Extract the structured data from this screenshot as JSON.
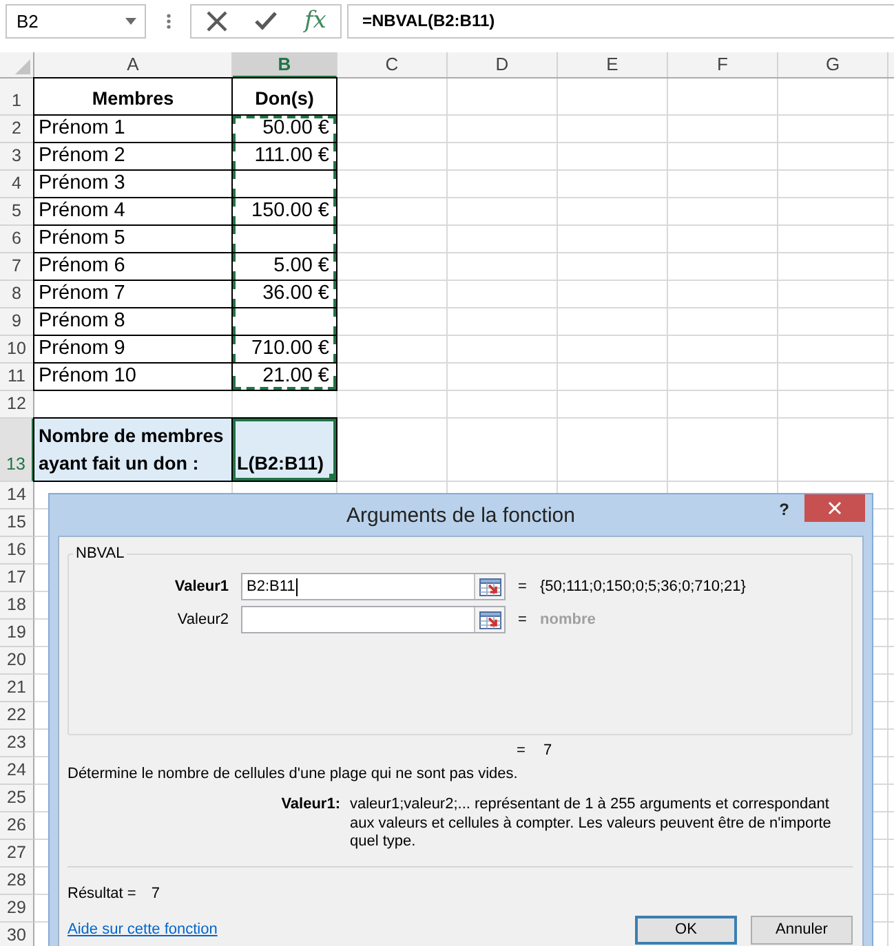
{
  "formula_bar": {
    "name_box": "B2",
    "insert_function": "fx",
    "formula": "=NBVAL(B2:B11)"
  },
  "sheet": {
    "columns": [
      {
        "label": "A",
        "selected": false
      },
      {
        "label": "B",
        "selected": true
      },
      {
        "label": "C",
        "selected": false
      },
      {
        "label": "D",
        "selected": false
      },
      {
        "label": "E",
        "selected": false
      },
      {
        "label": "F",
        "selected": false
      },
      {
        "label": "G",
        "selected": false
      }
    ],
    "rows": [
      {
        "number": "1",
        "selected": false,
        "kind": "header",
        "cells": [
          {
            "text": "Membres",
            "referenced": false,
            "active": false
          },
          {
            "text": "Don(s)",
            "referenced": false,
            "active": false
          }
        ]
      },
      {
        "number": "2",
        "selected": false,
        "kind": "entry",
        "cells": [
          {
            "text": "Prénom 1",
            "referenced": false,
            "active": false
          },
          {
            "text": "50.00 €",
            "referenced": true,
            "active": false
          }
        ]
      },
      {
        "number": "3",
        "selected": false,
        "kind": "entry",
        "cells": [
          {
            "text": "Prénom 2",
            "referenced": false,
            "active": false
          },
          {
            "text": "111.00 €",
            "referenced": true,
            "active": false
          }
        ]
      },
      {
        "number": "4",
        "selected": false,
        "kind": "entry",
        "cells": [
          {
            "text": "Prénom 3",
            "referenced": false,
            "active": false
          },
          {
            "referenced": true,
            "active": false
          }
        ]
      },
      {
        "number": "5",
        "selected": false,
        "kind": "entry",
        "cells": [
          {
            "text": "Prénom 4",
            "referenced": false,
            "active": false
          },
          {
            "text": "150.00 €",
            "referenced": true,
            "active": false
          }
        ]
      },
      {
        "number": "6",
        "selected": false,
        "kind": "entry",
        "cells": [
          {
            "text": "Prénom 5",
            "referenced": false,
            "active": false
          },
          {
            "referenced": true,
            "active": false
          }
        ]
      },
      {
        "number": "7",
        "selected": false,
        "kind": "entry",
        "cells": [
          {
            "text": "Prénom 6",
            "referenced": false,
            "active": false
          },
          {
            "text": "5.00 €",
            "referenced": true,
            "active": false
          }
        ]
      },
      {
        "number": "8",
        "selected": false,
        "kind": "entry",
        "cells": [
          {
            "text": "Prénom 7",
            "referenced": false,
            "active": false
          },
          {
            "text": "36.00 €",
            "referenced": true,
            "active": false
          }
        ]
      },
      {
        "number": "9",
        "selected": false,
        "kind": "entry",
        "cells": [
          {
            "text": "Prénom 8",
            "referenced": false,
            "active": false
          },
          {
            "referenced": true,
            "active": false
          }
        ]
      },
      {
        "number": "10",
        "selected": false,
        "kind": "entry",
        "cells": [
          {
            "text": "Prénom 9",
            "referenced": false,
            "active": false
          },
          {
            "text": "710.00 €",
            "referenced": true,
            "active": false
          }
        ]
      },
      {
        "number": "11",
        "selected": false,
        "kind": "entry",
        "cells": [
          {
            "text": "Prénom 10",
            "referenced": false,
            "active": false
          },
          {
            "text": "21.00 €",
            "referenced": true,
            "active": false
          }
        ]
      },
      {
        "number": "12",
        "selected": false,
        "kind": "blank"
      },
      {
        "number": "13",
        "selected": true,
        "kind": "summary",
        "cells": [
          {
            "text": "Nombre de membres ayant fait un don :",
            "referenced": false,
            "active": false
          },
          {
            "text": "L(B2:B11)",
            "referenced": false,
            "active": true
          }
        ]
      },
      {
        "number": "14",
        "selected": false,
        "kind": "blank"
      },
      {
        "number": "15",
        "selected": false,
        "kind": "blank"
      },
      {
        "number": "16",
        "selected": false,
        "kind": "blank"
      },
      {
        "number": "17",
        "selected": false,
        "kind": "blank"
      },
      {
        "number": "18",
        "selected": false,
        "kind": "blank"
      },
      {
        "number": "19",
        "selected": false,
        "kind": "blank"
      },
      {
        "number": "20",
        "selected": false,
        "kind": "blank"
      },
      {
        "number": "21",
        "selected": false,
        "kind": "blank"
      },
      {
        "number": "22",
        "selected": false,
        "kind": "blank"
      },
      {
        "number": "23",
        "selected": false,
        "kind": "blank"
      },
      {
        "number": "24",
        "selected": false,
        "kind": "blank"
      },
      {
        "number": "25",
        "selected": false,
        "kind": "blank"
      },
      {
        "number": "26",
        "selected": false,
        "kind": "blank"
      },
      {
        "number": "27",
        "selected": false,
        "kind": "blank"
      },
      {
        "number": "28",
        "selected": false,
        "kind": "blank"
      },
      {
        "number": "29",
        "selected": false,
        "kind": "blank"
      },
      {
        "number": "30",
        "selected": false,
        "kind": "blank"
      }
    ]
  },
  "dialog": {
    "title": "Arguments de la fonction",
    "help": "?",
    "function_name": "NBVAL",
    "arguments": [
      {
        "label": "Valeur1",
        "required": true,
        "focused": true,
        "value": "B2:B11",
        "equals": "=",
        "result": "{50;111;0;150;0;5;36;0;710;21}"
      },
      {
        "label": "Valeur2",
        "required": false,
        "focused": false,
        "equals": "=",
        "result_hint": "nombre"
      }
    ],
    "formula_result": {
      "equals": "=",
      "value": "7"
    },
    "description": "Détermine le nombre de cellules d'une plage qui ne sont pas vides.",
    "argument_help": {
      "label": "Valeur1:",
      "text": "valeur1;valeur2;... représentant de 1 à 255 arguments et correspondant aux valeurs et cellules à compter. Les valeurs peuvent être de n'importe quel type."
    },
    "result": {
      "label": "Résultat =",
      "value": "7"
    },
    "help_link": "Aide sur cette fonction",
    "buttons": [
      {
        "label": "OK",
        "default": true
      },
      {
        "label": "Annuler",
        "default": false
      }
    ]
  }
}
